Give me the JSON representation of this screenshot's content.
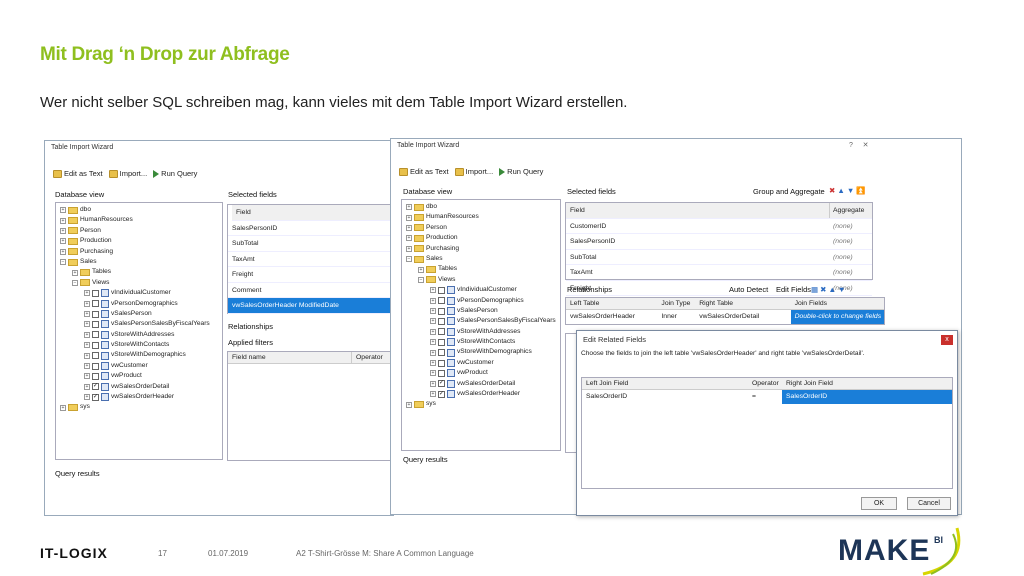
{
  "slide": {
    "title": "Mit Drag ‘n Drop zur Abfrage",
    "subtitle": "Wer nicht selber SQL schreiben mag, kann vieles mit dem Table Import Wizard erstellen."
  },
  "w1": {
    "title": "Table Import Wizard",
    "edit": "Edit as Text",
    "import": "Import...",
    "run": "Run Query",
    "db_view": "Database view",
    "selected": "Selected fields",
    "field_hdr": "Field",
    "fields": [
      "SalesPersonID",
      "SubTotal",
      "TaxAmt",
      "Freight",
      "Comment",
      "vwSalesOrderHeader ModifiedDate"
    ],
    "relationships": "Relationships",
    "applied": "Applied filters",
    "filt_cols": [
      "Field name",
      "Operator"
    ],
    "query_results": "Query results",
    "tree": [
      "dbo",
      "HumanResources",
      "Person",
      "Production",
      "Purchasing",
      "Sales",
      "Tables",
      "Views",
      "vIndividualCustomer",
      "vPersonDemographics",
      "vSalesPerson",
      "vSalesPersonSalesByFiscalYears",
      "vStoreWithAddresses",
      "vStoreWithContacts",
      "vStoreWithDemographics",
      "vwCustomer",
      "vwProduct",
      "vwSalesOrderDetail",
      "vwSalesOrderHeader",
      "sys"
    ]
  },
  "w2": {
    "title": "Table Import Wizard",
    "edit": "Edit as Text",
    "import": "Import...",
    "run": "Run Query",
    "db_view": "Database view",
    "selected": "Selected fields",
    "group": "Group and Aggregate",
    "field_hdr": "Field",
    "agg_hdr": "Aggregate",
    "fields": [
      [
        "CustomerID",
        "(none)"
      ],
      [
        "SalesPersonID",
        "(none)"
      ],
      [
        "SubTotal",
        "(none)"
      ],
      [
        "TaxAmt",
        "(none)"
      ],
      [
        "Freight",
        "(none)"
      ]
    ],
    "relationships": "Relationships",
    "auto": "Auto Detect",
    "editf": "Edit Fields",
    "rel_cols": [
      "Left Table",
      "Join Type",
      "Right Table",
      "Join Fields"
    ],
    "rel_row": [
      "vwSalesOrderHeader",
      "Inner",
      "vwSalesOrderDetail",
      "Double-click to change fields"
    ],
    "query_results": "Query results",
    "tree": [
      "dbo",
      "HumanResources",
      "Person",
      "Production",
      "Purchasing",
      "Sales",
      "Tables",
      "Views",
      "vIndividualCustomer",
      "vPersonDemographics",
      "vSalesPerson",
      "vSalesPersonSalesByFiscalYears",
      "vStoreWithAddresses",
      "vStoreWithContacts",
      "vStoreWithDemographics",
      "vwCustomer",
      "vwProduct",
      "vwSalesOrderDetail",
      "vwSalesOrderHeader",
      "sys"
    ]
  },
  "dlg": {
    "title": "Edit Related Fields",
    "close": "x",
    "msg": "Choose the fields to join the left table 'vwSalesOrderHeader' and right table 'vwSalesOrderDetail'.",
    "cols": [
      "Left Join Field",
      "Operator",
      "Right Join Field"
    ],
    "row": [
      "SalesOrderID",
      "=",
      "SalesOrderID"
    ],
    "ok": "OK",
    "cancel": "Cancel"
  },
  "footer": {
    "brand": "IT-LOGIX",
    "page": "17",
    "date": "01.07.2019",
    "text": "A2 T-Shirt-Grösse M: Share A Common Language",
    "logo": "MAKE",
    "logo_sup": "BI"
  }
}
